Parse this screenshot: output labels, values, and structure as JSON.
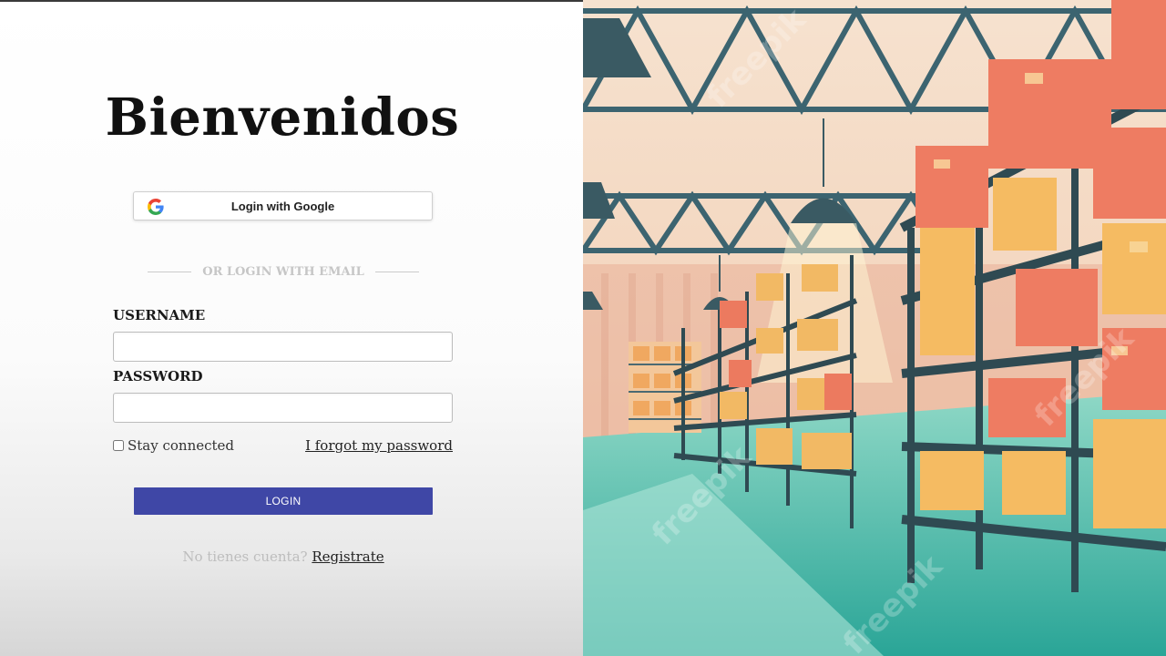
{
  "login": {
    "title": "Bienvenidos",
    "google_label": "Login with Google",
    "divider_text": "OR LOGIN WITH EMAIL",
    "username_label": "USERNAME",
    "username_value": "",
    "password_label": "PASSWORD",
    "password_value": "",
    "stay_connected_label": "Stay connected",
    "forgot_label": "I forgot my password",
    "login_button": "LOGIN",
    "register_question": "No tienes cuenta?",
    "register_link": "Registrate"
  },
  "colors": {
    "primary_button": "#3f47a6",
    "floor": "#3fb8a6",
    "shelf": "#2f4a52",
    "box_orange": "#f0b25e",
    "box_red": "#e8705a"
  },
  "illustration": {
    "subject": "warehouse-shelves-illustration",
    "watermark": "freepik"
  }
}
